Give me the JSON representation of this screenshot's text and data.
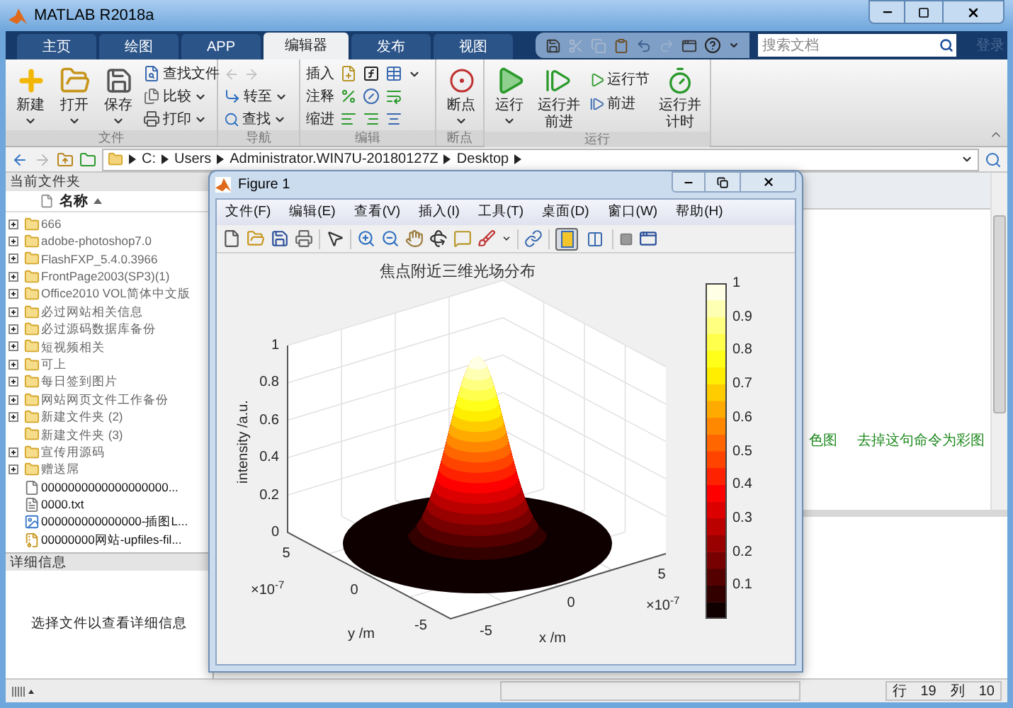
{
  "window": {
    "title": "MATLAB R2018a"
  },
  "tabs": [
    {
      "label": "主页",
      "selected": false
    },
    {
      "label": "绘图",
      "selected": false
    },
    {
      "label": "APP",
      "selected": false
    },
    {
      "label": "编辑器",
      "selected": true
    },
    {
      "label": "发布",
      "selected": false
    },
    {
      "label": "视图",
      "selected": false
    }
  ],
  "quick_access": {
    "cut_disabled": true,
    "copy_disabled": true
  },
  "search": {
    "placeholder": "搜索文档"
  },
  "login": {
    "label": "登录",
    "disabled": true
  },
  "ribbon": {
    "file": {
      "label": "文件",
      "big_buttons": [
        {
          "kind": "new",
          "label": "新建"
        },
        {
          "kind": "open",
          "label": "打开"
        },
        {
          "kind": "save",
          "label": "保存"
        }
      ],
      "small_buttons": [
        {
          "kind": "find",
          "label": "查找文件",
          "dropdown": false
        },
        {
          "kind": "compare",
          "label": "比较",
          "dropdown": true
        },
        {
          "kind": "print",
          "label": "打印",
          "dropdown": true
        }
      ]
    },
    "navigate": {
      "label": "导航",
      "history_disabled": true,
      "buttons": [
        {
          "kind": "goto",
          "label": "转至",
          "dropdown": true
        },
        {
          "kind": "find",
          "label": "查找",
          "dropdown": true
        }
      ]
    },
    "edit": {
      "label": "编辑",
      "rows": [
        {
          "kind": "insert",
          "label": "插入"
        },
        {
          "kind": "comment",
          "label": "注释"
        },
        {
          "kind": "indent",
          "label": "缩进"
        }
      ]
    },
    "breakpoints": {
      "label": "断点",
      "button": "断点"
    },
    "run": {
      "label": "运行",
      "run": "运行",
      "run_advance": "运行并前进",
      "run_section": "运行节",
      "advance": "前进",
      "run_time": "运行并计时"
    }
  },
  "address_bar": {
    "back_disabled": false,
    "forward_disabled": true,
    "segments": [
      "C:",
      "Users",
      "Administrator.WIN7U-20180127Z",
      "Desktop"
    ]
  },
  "current_folder": {
    "title": "当前文件夹",
    "column": "名称",
    "items": [
      {
        "name": "666",
        "kind": "folder",
        "expandable": true
      },
      {
        "name": "adobe-photoshop7.0",
        "kind": "folder",
        "expandable": true
      },
      {
        "name": "FlashFXP_5.4.0.3966",
        "kind": "folder",
        "expandable": true
      },
      {
        "name": "FrontPage2003(SP3)(1)",
        "kind": "folder",
        "expandable": true
      },
      {
        "name": "Office2010 VOL简体中文版",
        "kind": "folder",
        "expandable": true
      },
      {
        "name": "必过网站相关信息",
        "kind": "folder",
        "expandable": true
      },
      {
        "name": "必过源码数据库备份",
        "kind": "folder",
        "expandable": true
      },
      {
        "name": "短视频相关",
        "kind": "folder",
        "expandable": true
      },
      {
        "name": "可上",
        "kind": "folder",
        "expandable": true
      },
      {
        "name": "每日签到图片",
        "kind": "folder",
        "expandable": true
      },
      {
        "name": "网站网页文件工作备份",
        "kind": "folder",
        "expandable": true
      },
      {
        "name": "新建文件夹 (2)",
        "kind": "folder",
        "expandable": true
      },
      {
        "name": "新建文件夹 (3)",
        "kind": "folder",
        "expandable": false
      },
      {
        "name": "宣传用源码",
        "kind": "folder",
        "expandable": true
      },
      {
        "name": "赠送屌",
        "kind": "folder",
        "expandable": true
      },
      {
        "name": "0000000000000000000...",
        "kind": "figure",
        "expandable": false
      },
      {
        "name": "0000.txt",
        "kind": "text",
        "expandable": false
      },
      {
        "name": "000000000000000-插图L...",
        "kind": "image",
        "expandable": false
      },
      {
        "name": "00000000网站-upfiles-fil...",
        "kind": "archive",
        "expandable": false
      }
    ]
  },
  "details": {
    "title": "详细信息",
    "message": "选择文件以查看详细信息"
  },
  "editor": {
    "texts": [
      "色图",
      "去掉这句命令为彩图"
    ]
  },
  "status_bar": {
    "row_label": "行",
    "row": "19",
    "col_label": "列",
    "col": "10"
  },
  "figure": {
    "title": "Figure 1",
    "menu": [
      "文件(F)",
      "编辑(E)",
      "查看(V)",
      "插入(I)",
      "工具(T)",
      "桌面(D)",
      "窗口(W)",
      "帮助(H)"
    ],
    "colorbar_on": true,
    "legend_on": false,
    "plot": {
      "title": "焦点附近三维光场分布",
      "zlabel": "intensity /a.u.",
      "xlabel": "x /m",
      "ylabel": "y /m",
      "z_ticks": [
        "1",
        "0.8",
        "0.6",
        "0.4",
        "0.2",
        "0"
      ],
      "x_ticks": [
        "-5",
        "0",
        "5"
      ],
      "y_ticks": [
        "5",
        "0",
        "-5"
      ],
      "x_exponent": "×10$^{-7}$",
      "y_exponent": "×10$^{-7}$",
      "colorbar_ticks": [
        "1",
        "0.9",
        "0.8",
        "0.7",
        "0.6",
        "0.5",
        "0.4",
        "0.3",
        "0.2",
        "0.1"
      ]
    }
  }
}
